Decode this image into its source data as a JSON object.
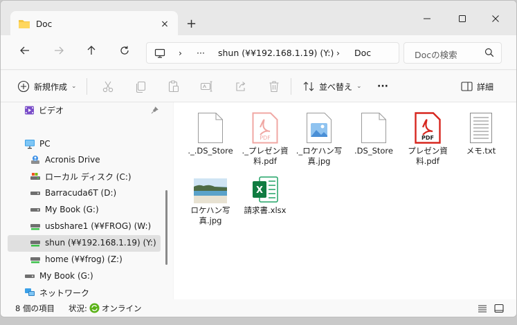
{
  "window": {
    "tab_title": "Doc",
    "tab_close": "×",
    "new_tab": "+"
  },
  "address_bar": {
    "ellipsis": "···",
    "location": "shun (¥¥192.168.1.19) (Y:)",
    "current": "Doc"
  },
  "search": {
    "placeholder": "Docの検索"
  },
  "toolbar": {
    "new_label": "新規作成",
    "sort_label": "並べ替え",
    "more_label": "···",
    "details_label": "詳細"
  },
  "sidebar": {
    "items": [
      {
        "label": "ビデオ",
        "icon": "video-folder-icon"
      },
      {
        "label": "PC",
        "icon": "pc-icon"
      },
      {
        "label": "Acronis Drive",
        "icon": "cloud-drive-icon"
      },
      {
        "label": "ローカル ディスク (C:)",
        "icon": "local-disk-icon"
      },
      {
        "label": "Barracuda6T (D:)",
        "icon": "drive-icon"
      },
      {
        "label": "My Book (G:)",
        "icon": "drive-icon"
      },
      {
        "label": "usbshare1 (¥¥FROG) (W:)",
        "icon": "network-drive-icon"
      },
      {
        "label": "shun (¥¥192.168.1.19) (Y:)",
        "icon": "network-drive-icon"
      },
      {
        "label": "home (¥¥frog) (Z:)",
        "icon": "network-drive-icon"
      },
      {
        "label": "My Book (G:)",
        "icon": "drive-icon"
      },
      {
        "label": "ネットワーク",
        "icon": "network-icon"
      }
    ]
  },
  "files": [
    {
      "name": "._.DS_Store",
      "icon": "blank-file-icon"
    },
    {
      "name": "._プレゼン資料.pdf",
      "icon": "pdf-file-faded-icon"
    },
    {
      "name": "._ロケハン写真.jpg",
      "icon": "image-file-icon"
    },
    {
      "name": ".DS_Store",
      "icon": "blank-file-icon"
    },
    {
      "name": "プレゼン資料.pdf",
      "icon": "pdf-file-icon"
    },
    {
      "name": "メモ.txt",
      "icon": "text-file-icon"
    },
    {
      "name": "ロケハン写真.jpg",
      "icon": "photo-thumbnail-icon"
    },
    {
      "name": "請求書.xlsx",
      "icon": "excel-file-icon"
    }
  ],
  "pdf_badge": "PDF",
  "excel_badge": "X",
  "status": {
    "item_count": "8 個の項目",
    "status_label": "状況:",
    "status_value": "オンライン"
  },
  "colors": {
    "accent": "#0067c0",
    "pdf_red": "#d7261e",
    "excel_green": "#107c41",
    "online_green": "#5bb319"
  }
}
